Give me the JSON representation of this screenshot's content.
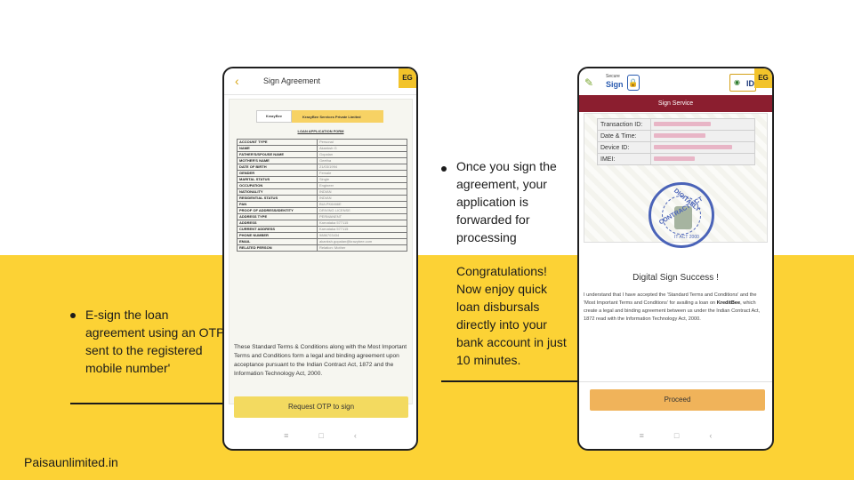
{
  "captions": {
    "left": "E-sign the loan agreement using an OTP sent to the registered mobile number'",
    "right_1": "Once you sign the agreement, your application is forwarded for processing",
    "right_2": "Congratulations! Now enjoy quick loan disbursals directly into your bank account in just 10 minutes."
  },
  "brand": "Paisaunlimited.in",
  "colors": {
    "band": "#fcd235",
    "service_bar": "#8b1e2f",
    "proceed_button": "#f0b35a",
    "otp_button": "#f3da60"
  },
  "phone1": {
    "title": "Sign Agreement",
    "badge": "EG",
    "back_icon": "chevron-left-icon",
    "document": {
      "logo": "KrazyBee",
      "company": "KrazyBee Services Private Limited",
      "form_title": "LOAN APPLICATION FORM",
      "fields": [
        {
          "label": "ACCOUNT TYPE",
          "value": "Personal"
        },
        {
          "label": "NAME",
          "value": "Akanksh G"
        },
        {
          "label": "FATHER'S/SPOUSE NAME",
          "value": "Gopalan"
        },
        {
          "label": "MOTHER'S NAME",
          "value": "Geetha"
        },
        {
          "label": "DATE OF BIRTH",
          "value": "21/03/1994"
        },
        {
          "label": "GENDER",
          "value": "Female"
        },
        {
          "label": "MARITAL STATUS",
          "value": "Single"
        },
        {
          "label": "OCCUPATION",
          "value": "Engineer"
        },
        {
          "label": "NATIONALITY",
          "value": "INDIAN"
        },
        {
          "label": "RESIDENTIAL STATUS",
          "value": "INDIAN"
        },
        {
          "label": "PAN",
          "value": "BULPK6466E"
        },
        {
          "label": "PROOF OF ADDRESS/IDENTITY",
          "value": "DRIVING LICENSE"
        },
        {
          "label": "ADDRESS TYPE",
          "value": "PERMANENT"
        },
        {
          "label": "ADDRESS",
          "value": "Karnataka 577115"
        },
        {
          "label": "CURRENT ADDRESS",
          "value": "Karnataka 577115"
        },
        {
          "label": "PHONE NUMBER",
          "value": "9886703434"
        },
        {
          "label": "EMAIL",
          "value": "akanksh.gopalan@krazybee.com"
        },
        {
          "label": "RELATED PERSON",
          "value": "Relation: Mother"
        }
      ]
    },
    "terms": "These Standard Terms & Conditions along with the Most Important Terms and Conditions form a legal and binding agreement upon acceptance pursuant to the Indian Contract Act, 1872 and the Information Technology Act, 2000.",
    "button": "Request OTP to sign"
  },
  "phone2": {
    "badge": "EG",
    "logo_secure": "Secure",
    "logo_sign": "Sign",
    "logo_id": "ID",
    "service": "Sign Service",
    "info": [
      {
        "label": "Transaction ID:",
        "value": ""
      },
      {
        "label": "Date & Time:",
        "value": ""
      },
      {
        "label": "Device ID:",
        "value": ""
      },
      {
        "label": "IMEI:",
        "value": ""
      }
    ],
    "stamp": {
      "top": "CONTRACT ACT",
      "middle": "DIGITALLY",
      "bottom": "IT ACT 2000"
    },
    "success": "Digital Sign Success !",
    "text_1": "I understand that I have accepted the 'Standard Terms and Conditions' and the 'Most Important Terms and Conditions' for availing a loan on ",
    "text_brand": "KreditBee",
    "text_2": ", which create a legal and binding agreement between us under the Indian Contract Act, 1872 read with the Information Technology Act, 2000.",
    "button": "Proceed"
  },
  "nav": {
    "menu": "≡",
    "home": "□",
    "back": "‹"
  }
}
